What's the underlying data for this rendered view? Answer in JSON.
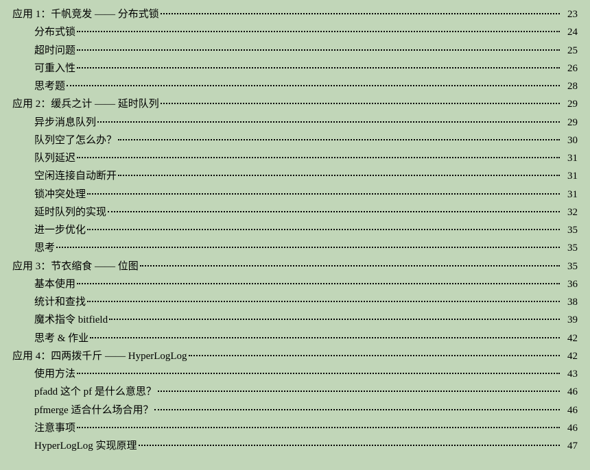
{
  "toc": [
    {
      "level": 0,
      "title": "应用 1：千帆竞发 —— 分布式锁",
      "page": "23"
    },
    {
      "level": 1,
      "title": "分布式锁",
      "page": "24"
    },
    {
      "level": 1,
      "title": "超时问题",
      "page": "25"
    },
    {
      "level": 1,
      "title": "可重入性",
      "page": "26"
    },
    {
      "level": 1,
      "title": "思考题",
      "page": "28"
    },
    {
      "level": 0,
      "title": "应用 2：缓兵之计 —— 延时队列",
      "page": "29"
    },
    {
      "level": 1,
      "title": "异步消息队列",
      "page": "29"
    },
    {
      "level": 1,
      "title": "队列空了怎么办？",
      "page": "30"
    },
    {
      "level": 1,
      "title": "队列延迟",
      "page": "31"
    },
    {
      "level": 1,
      "title": "空闲连接自动断开",
      "page": "31"
    },
    {
      "level": 1,
      "title": "锁冲突处理",
      "page": "31"
    },
    {
      "level": 1,
      "title": "延时队列的实现",
      "page": "32"
    },
    {
      "level": 1,
      "title": "进一步优化",
      "page": "35"
    },
    {
      "level": 1,
      "title": "思考",
      "page": "35"
    },
    {
      "level": 0,
      "title": "应用 3：节衣缩食 —— 位图",
      "page": "35"
    },
    {
      "level": 1,
      "title": "基本使用",
      "page": "36"
    },
    {
      "level": 1,
      "title": "统计和查找",
      "page": "38"
    },
    {
      "level": 1,
      "title": "魔术指令 bitfield",
      "page": "39"
    },
    {
      "level": 1,
      "title": "思考 & 作业",
      "page": "42"
    },
    {
      "level": 0,
      "title": "应用 4：四两拨千斤 —— HyperLogLog",
      "page": "42"
    },
    {
      "level": 1,
      "title": "使用方法",
      "page": "43"
    },
    {
      "level": 1,
      "title": "pfadd 这个 pf 是什么意思？",
      "page": "46"
    },
    {
      "level": 1,
      "title": "pfmerge 适合什么场合用？",
      "page": "46"
    },
    {
      "level": 1,
      "title": "注意事项",
      "page": "46"
    },
    {
      "level": 1,
      "title": "HyperLogLog 实现原理",
      "page": "47"
    }
  ]
}
